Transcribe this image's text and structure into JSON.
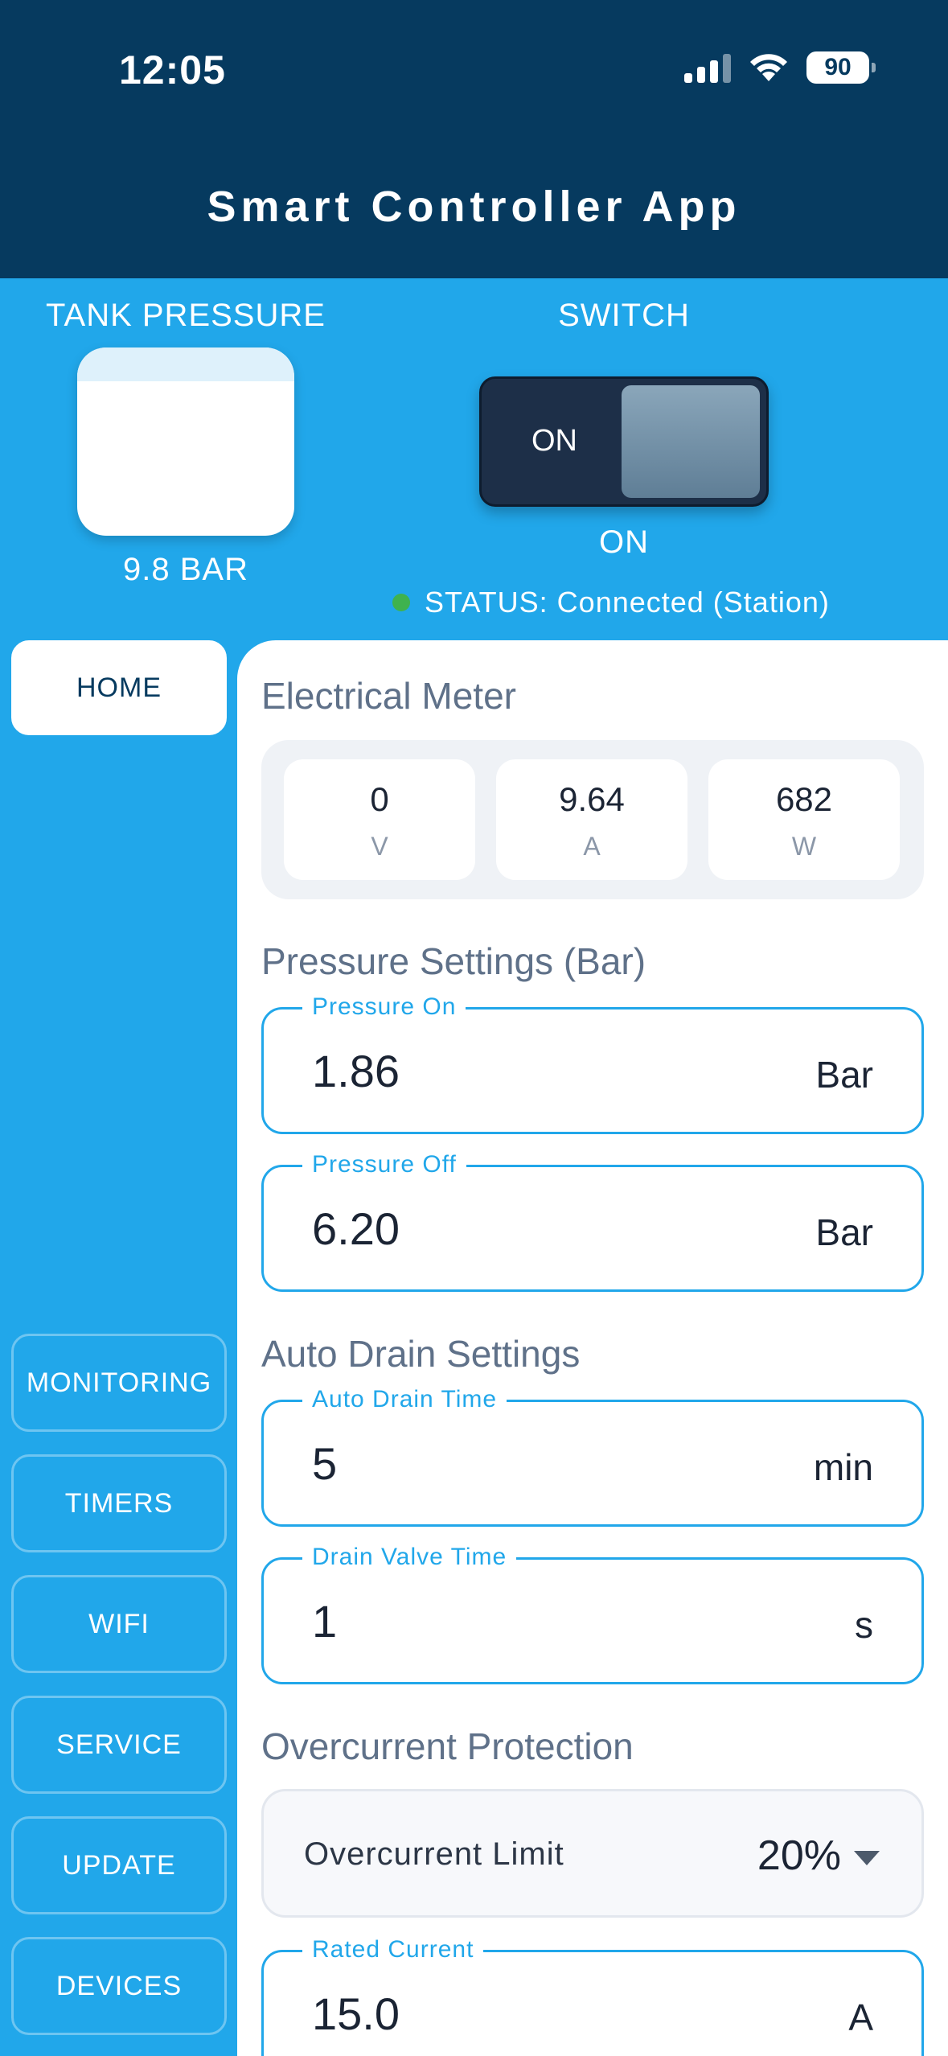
{
  "status_bar": {
    "time": "12:05",
    "battery": "90"
  },
  "header": {
    "title": "Smart Controller App"
  },
  "tank": {
    "label": "TANK PRESSURE",
    "value": "9.8 BAR"
  },
  "switch": {
    "label": "SWITCH",
    "toggle_text": "ON",
    "state": "ON",
    "status": "STATUS: Connected (Station)"
  },
  "colors": {
    "header_bg": "#063a5f",
    "accent": "#21a7ea",
    "status_ok": "#3fb24f"
  },
  "nav": {
    "items": [
      {
        "label": "HOME"
      },
      {
        "label": "MONITORING"
      },
      {
        "label": "TIMERS"
      },
      {
        "label": "WIFI"
      },
      {
        "label": "SERVICE"
      },
      {
        "label": "UPDATE"
      },
      {
        "label": "DEVICES"
      }
    ]
  },
  "meter": {
    "title": "Electrical Meter",
    "readings": [
      {
        "value": "0",
        "unit": "V"
      },
      {
        "value": "9.64",
        "unit": "A"
      },
      {
        "value": "682",
        "unit": "W"
      }
    ]
  },
  "pressure": {
    "title": "Pressure Settings (Bar)",
    "on": {
      "label": "Pressure On",
      "value": "1.86",
      "unit": "Bar"
    },
    "off": {
      "label": "Pressure Off",
      "value": "6.20",
      "unit": "Bar"
    }
  },
  "drain": {
    "title": "Auto Drain Settings",
    "auto_time": {
      "label": "Auto Drain Time",
      "value": "5",
      "unit": "min"
    },
    "valve_time": {
      "label": "Drain Valve Time",
      "value": "1",
      "unit": "s"
    }
  },
  "overcurrent": {
    "title": "Overcurrent Protection",
    "limit": {
      "label": "Overcurrent Limit",
      "value": "20%"
    },
    "rated": {
      "label": "Rated Current",
      "value": "15.0",
      "unit": "A"
    }
  }
}
